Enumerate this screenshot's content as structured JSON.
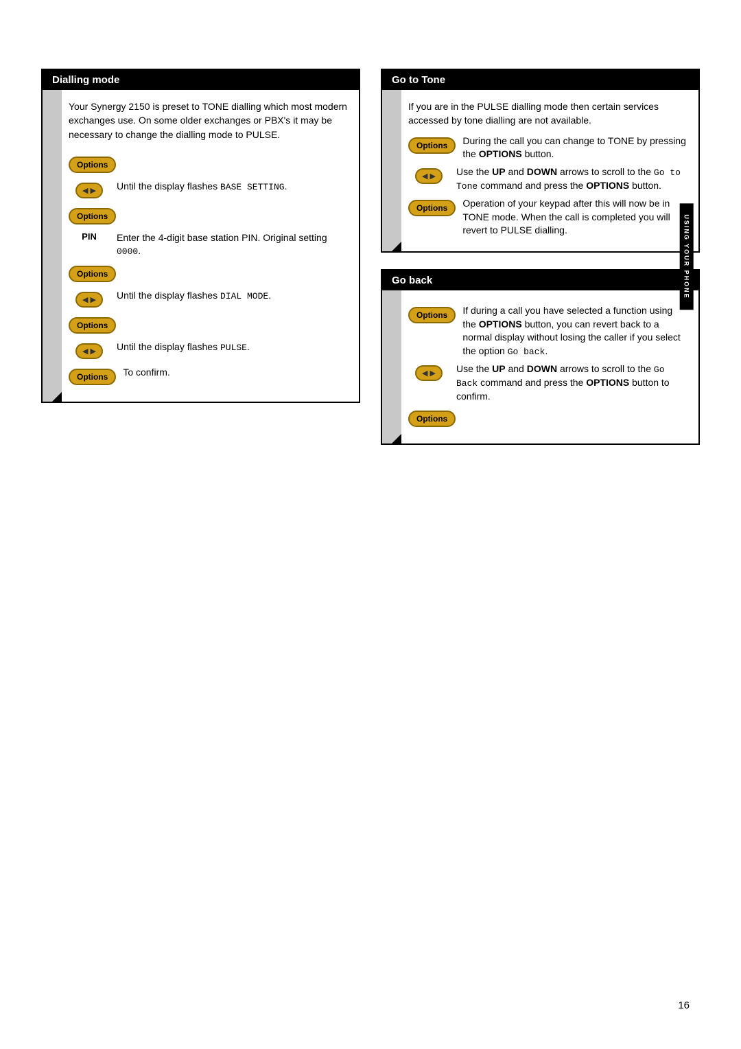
{
  "page": {
    "number": "16",
    "side_tab": "USING YOUR PHONE"
  },
  "left_section": {
    "title": "Dialling mode",
    "intro": "Your Synergy 2150 is preset to TONE dialling which most modern exchanges use. On some older exchanges or PBX's it may be necessary to change the dialling mode to PULSE.",
    "steps": [
      {
        "icon_type": "options",
        "text": ""
      },
      {
        "icon_type": "arrow",
        "text": "Until the display flashes BASE SETTING."
      },
      {
        "icon_type": "options",
        "text": ""
      },
      {
        "icon_type": "pin",
        "text": "Enter the 4-digit base station PIN. Original setting 0000."
      },
      {
        "icon_type": "options",
        "text": ""
      },
      {
        "icon_type": "arrow",
        "text": "Until the display flashes DIAL MODE."
      },
      {
        "icon_type": "options",
        "text": ""
      },
      {
        "icon_type": "arrow",
        "text": "Until the display flashes PULSE."
      },
      {
        "icon_type": "options",
        "text": "To confirm."
      }
    ]
  },
  "right_top_section": {
    "title": "Go to Tone",
    "intro_1": "If you are in the PULSE dialling mode then certain services accessed by tone dialling are not available.",
    "intro_2": "During the call you can change to TONE by pressing the OPTIONS button.",
    "step_1_text": "Use the UP and DOWN arrows to scroll to the Go to Tone command and press the OPTIONS button.",
    "step_2_text": "Operation of your keypad after this will now be in TONE mode. When the call is completed you will revert to PULSE dialling."
  },
  "right_bottom_section": {
    "title": "Go back",
    "intro": "If during a call you have selected a function using the OPTIONS button, you can revert back to a normal display without losing the caller if you select the option Go back.",
    "step_1_text": "Use the UP and DOWN arrows to scroll to the Go Back command and press the OPTIONS button to confirm."
  },
  "buttons": {
    "options_label": "Options",
    "up_symbol": "▲",
    "down_symbol": "▼"
  }
}
